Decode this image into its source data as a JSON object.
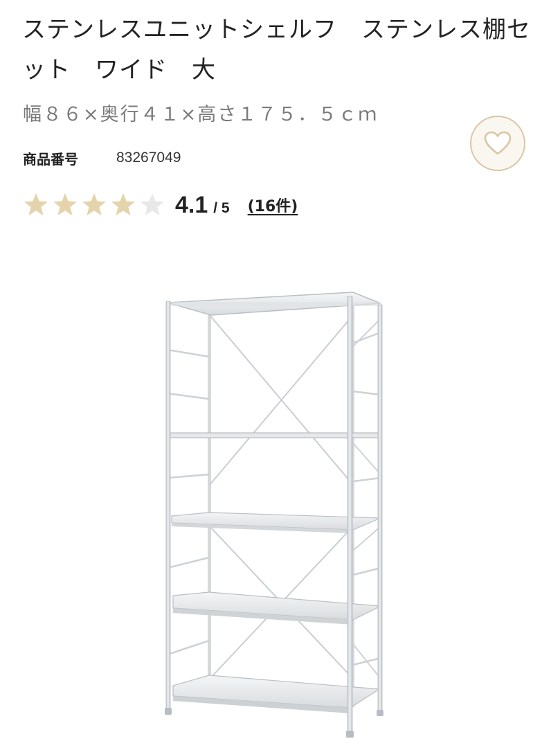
{
  "product": {
    "title": "ステンレスユニットシェルフ　ステンレス棚セット　ワイド　大",
    "spec": "幅８６×奥行４１×高さ１７５．５ｃｍ",
    "product_number_label": "商品番号",
    "product_number": "83267049"
  },
  "rating": {
    "score": "4.1",
    "out_of": "/ 5",
    "value": 4.1,
    "max": 5,
    "review_count_label": "(16件)"
  },
  "favorite": {
    "icon": "heart-icon"
  },
  "image": {
    "subject": "stainless-steel-shelf-unit"
  },
  "colors": {
    "star_filled": "#e5d3ab",
    "star_empty": "#e8e8e8",
    "favorite_border": "#d9c6a2",
    "favorite_bg": "#faf7f1",
    "spec_text": "#7a7a7a"
  }
}
